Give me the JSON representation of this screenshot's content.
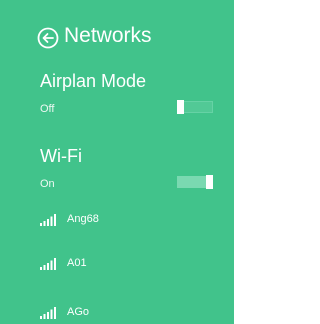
{
  "header": {
    "title": "Networks",
    "back_icon": "back-arrow-circle-icon"
  },
  "airplane": {
    "heading": "Airplan Mode",
    "state_label": "Off",
    "enabled": false
  },
  "wifi": {
    "heading": "Wi-Fi",
    "state_label": "On",
    "enabled": true,
    "networks": [
      {
        "name": "Ang68",
        "icon": "wifi-signal-icon"
      },
      {
        "name": "A01",
        "icon": "wifi-signal-icon"
      },
      {
        "name": "AGo",
        "icon": "wifi-signal-icon"
      }
    ]
  },
  "colors": {
    "accent": "#41c38b",
    "text": "#ffffff"
  }
}
